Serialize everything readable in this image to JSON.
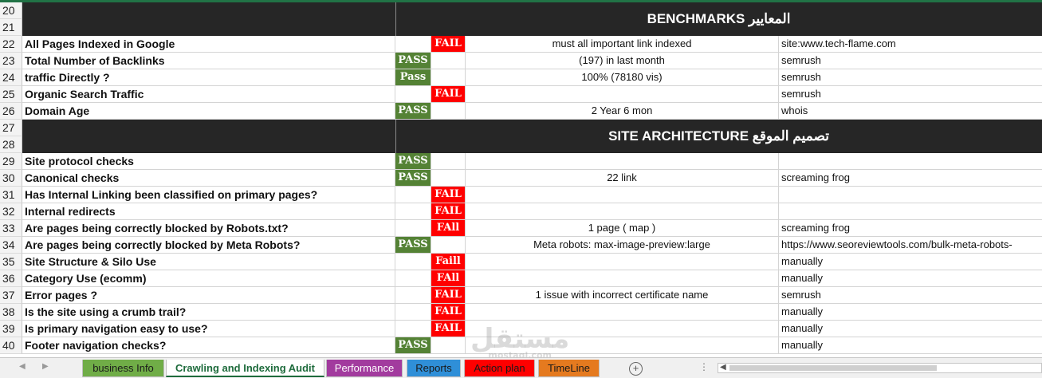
{
  "sheet": {
    "sections": [
      {
        "rows": [
          "20",
          "21"
        ],
        "title": "BENCHMARKS المعايير"
      },
      {
        "rows": [
          "27",
          "28"
        ],
        "title": "SITE ARCHITECTURE تصميم الموقع"
      }
    ],
    "rows": [
      {
        "num": "22",
        "label": "All  Pages Indexed in Google",
        "pass": "",
        "fail": "FAIL",
        "detail": "must all important link indexed",
        "tool": "site:www.tech-flame.com"
      },
      {
        "num": "23",
        "label": "Total Number of Backlinks",
        "pass": "PASS",
        "fail": "",
        "detail": "(197) in last month",
        "tool": "semrush"
      },
      {
        "num": "24",
        "label": "traffic Directly ?",
        "pass": "Pass",
        "fail": "",
        "detail": "100% (78180 vis)",
        "tool": "semrush"
      },
      {
        "num": "25",
        "label": "Organic Search Traffic",
        "pass": "",
        "fail": "FAIL",
        "detail": "",
        "tool": "semrush"
      },
      {
        "num": "26",
        "label": "Domain Age",
        "pass": "PASS",
        "fail": "",
        "detail": "2 Year 6 mon",
        "tool": "whois"
      },
      {
        "num": "29",
        "label": "Site protocol checks",
        "pass": "PASS",
        "fail": "",
        "detail": "",
        "tool": ""
      },
      {
        "num": "30",
        "label": "Canonical checks",
        "pass": "PASS",
        "fail": "",
        "detail": "22 link",
        "tool": "screaming frog"
      },
      {
        "num": "31",
        "label": "Has Internal Linking been classified on primary pages?",
        "pass": "",
        "fail": "FAIL",
        "detail": "",
        "tool": ""
      },
      {
        "num": "32",
        "label": "Internal redirects",
        "pass": "",
        "fail": "FAIL",
        "detail": "",
        "tool": ""
      },
      {
        "num": "33",
        "label": "Are pages being correctly blocked by Robots.txt?",
        "pass": "",
        "fail": "FAll",
        "detail": "1 page ( map )",
        "tool": "screaming frog"
      },
      {
        "num": "34",
        "label": "Are pages being correctly blocked by Meta Robots?",
        "pass": "PASS",
        "fail": "",
        "detail": "Meta robots: max-image-preview:large",
        "tool": "https://www.seoreviewtools.com/bulk-meta-robots-"
      },
      {
        "num": "35",
        "label": "Site Structure & Silo Use",
        "pass": "",
        "fail": "Faill",
        "detail": "",
        "tool": "manually"
      },
      {
        "num": "36",
        "label": "Category Use (ecomm)",
        "pass": "",
        "fail": "FAll",
        "detail": "",
        "tool": "manually"
      },
      {
        "num": "37",
        "label": "Error  pages ?",
        "pass": "",
        "fail": "FAIL",
        "detail": "1 issue with incorrect certificate name",
        "tool": "semrush"
      },
      {
        "num": "38",
        "label": "Is the site using a crumb trail?",
        "pass": "",
        "fail": "FAIL",
        "detail": "",
        "tool": "manually"
      },
      {
        "num": "39",
        "label": "Is primary navigation easy to use?",
        "pass": "",
        "fail": "FAIL",
        "detail": "",
        "tool": "manually"
      },
      {
        "num": "40",
        "label": "Footer navigation checks?",
        "pass": "PASS",
        "fail": "",
        "detail": "",
        "tool": "manually"
      }
    ]
  },
  "watermark": {
    "text": "مستقل",
    "sub": "mostaql.com"
  },
  "tabs": [
    {
      "label": "business Info",
      "color": "#70ad47",
      "text_color": "#1a1a1a",
      "active": false
    },
    {
      "label": "Crawling and Indexing Audit",
      "color": "#ffffff",
      "text_color": "#1e6b3c",
      "active": true
    },
    {
      "label": "Performance",
      "color": "#a23b9e",
      "text_color": "#ffffff",
      "active": false
    },
    {
      "label": "Reports",
      "color": "#2f8fd8",
      "text_color": "#1a1a1a",
      "active": false
    },
    {
      "label": "Action plan",
      "color": "#ff0000",
      "text_color": "#1a1a1a",
      "active": false
    },
    {
      "label": "TimeLine",
      "color": "#e57a1f",
      "text_color": "#1a1a1a",
      "active": false
    }
  ],
  "colors": {
    "pass": "#548235",
    "fail": "#ff0000",
    "header": "#262626"
  }
}
